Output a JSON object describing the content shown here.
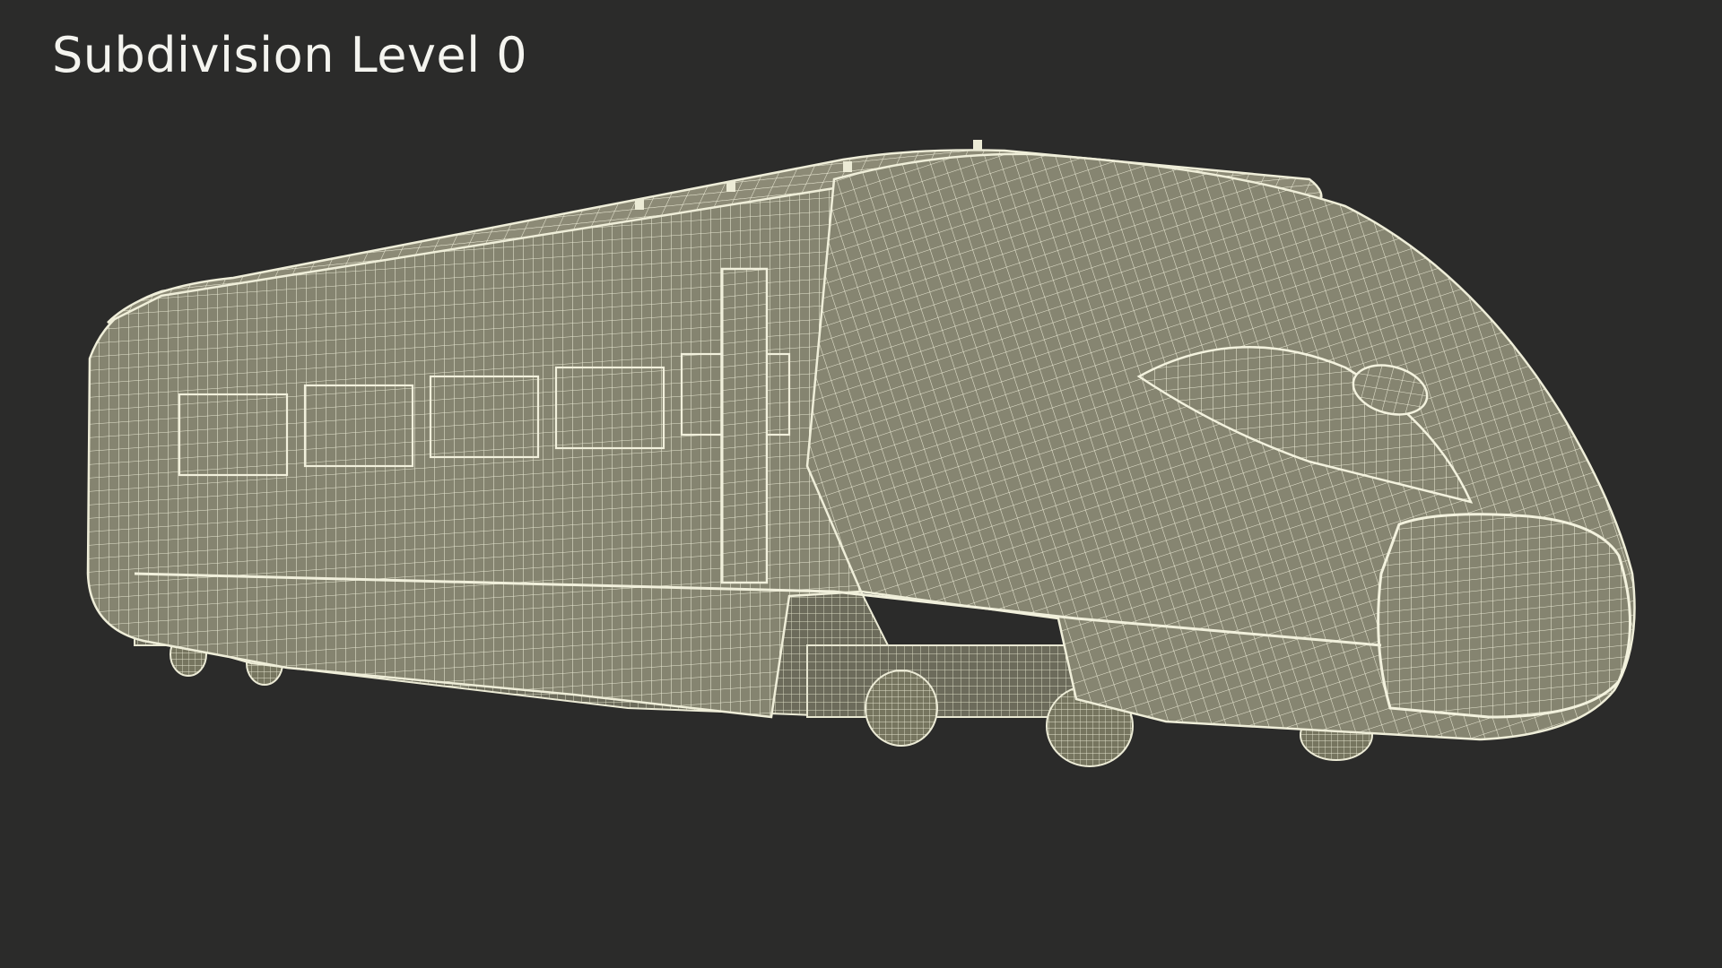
{
  "viewport": {
    "label": "Subdivision Level 0",
    "background_color": "#2b2b2a",
    "mesh_fill_color": "#85836f",
    "wire_color": "#ecebd6"
  },
  "model": {
    "subject": "high-speed-train-locomotive",
    "render_style": "wireframe-over-shaded"
  }
}
